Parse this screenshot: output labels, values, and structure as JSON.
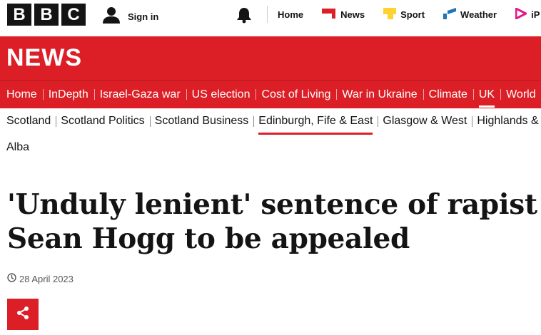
{
  "topbar": {
    "logo_letters": [
      "B",
      "B",
      "C"
    ],
    "signin_label": "Sign in",
    "nav": [
      {
        "label": "Home",
        "icon": "none"
      },
      {
        "label": "News",
        "icon": "news-icon",
        "color": "#dc1f26"
      },
      {
        "label": "Sport",
        "icon": "sport-icon",
        "color": "#ffd230"
      },
      {
        "label": "Weather",
        "icon": "weather-icon",
        "color": "#1f75b6"
      },
      {
        "label": "iP",
        "icon": "iplayer-icon",
        "color": "#e3198a"
      }
    ]
  },
  "banner": {
    "logo_text": "NEWS",
    "color": "#dc1f26"
  },
  "primary_nav": {
    "items": [
      "Home",
      "InDepth",
      "Israel-Gaza war",
      "US election",
      "Cost of Living",
      "War in Ukraine",
      "Climate",
      "UK",
      "World"
    ],
    "active": "UK"
  },
  "secondary_nav": {
    "items": [
      "Scotland",
      "Scotland Politics",
      "Scotland Business",
      "Edinburgh, Fife & East",
      "Glasgow & West",
      "Highlands & Islands"
    ],
    "active": "Edinburgh, Fife & East",
    "overflow_item": "Alba"
  },
  "article": {
    "headline": "'Unduly lenient' sentence of rapist Sean Hogg to be appealed",
    "date": "28 April 2023"
  },
  "share": {
    "icon": "share-icon"
  }
}
